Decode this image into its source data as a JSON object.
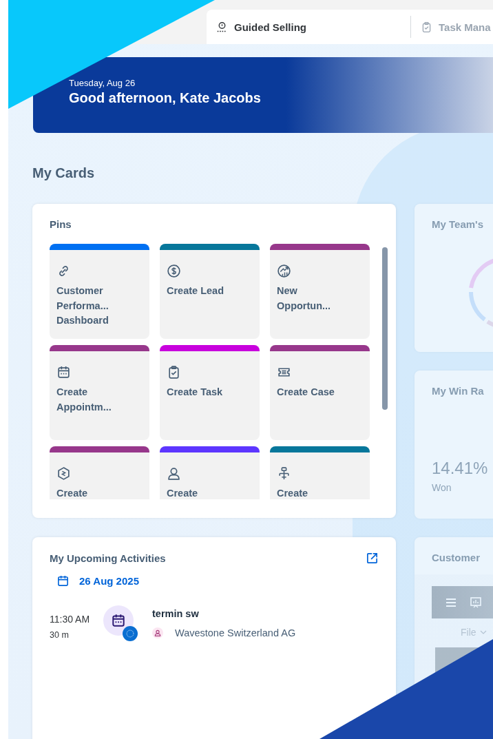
{
  "tabs": [
    {
      "label": "Guided Selling",
      "kind": "guide",
      "selected": true
    },
    {
      "label": "Task Mana",
      "kind": "clipboard",
      "selected": false
    }
  ],
  "banner": {
    "date": "Tuesday, Aug 26",
    "greeting": "Good afternoon, Kate Jacobs"
  },
  "section_title": "My Cards",
  "pins": {
    "title": "Pins",
    "tiles": [
      {
        "label": "Customer Performa... Dashboard",
        "kind": "link",
        "color": "#0070f2"
      },
      {
        "label": "Create Lead",
        "kind": "dollar",
        "color": "#07779b"
      },
      {
        "label": "New Opportun...",
        "kind": "opportunity",
        "color": "#97378b"
      },
      {
        "label": "Create Appointm...",
        "kind": "calendar",
        "color": "#97378b"
      },
      {
        "label": "Create Task",
        "kind": "task",
        "color": "#c800dd"
      },
      {
        "label": "Create Case",
        "kind": "ticket",
        "color": "#97378b"
      },
      {
        "label": "Create",
        "kind": "hexagon",
        "color": "#97378b"
      },
      {
        "label": "Create",
        "kind": "person",
        "color": "#5d36ff"
      },
      {
        "label": "Create",
        "kind": "org",
        "color": "#07779b"
      }
    ]
  },
  "team_card": {
    "title": "My Team's"
  },
  "win_card": {
    "title": "My Win Ra",
    "value": "14.41%",
    "caption": "Won"
  },
  "activities": {
    "title": "My Upcoming Activities",
    "date": "26 Aug 2025",
    "items": [
      {
        "time": "11:30 AM",
        "duration": "30 m",
        "title": "termin sw",
        "account": "Wavestone Switzerland AG"
      }
    ]
  },
  "customer_card": {
    "title": "Customer",
    "menu": "File"
  }
}
